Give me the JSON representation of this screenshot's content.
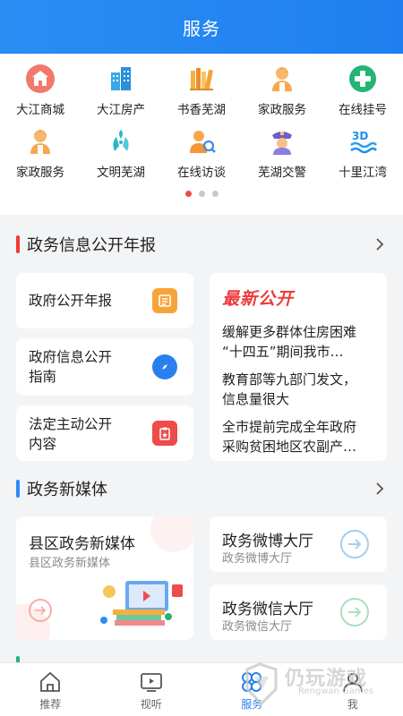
{
  "header": {
    "title": "服务"
  },
  "services": [
    {
      "label": "大江商城",
      "icon": "shopping-mall-icon",
      "color": "#ee6b5a"
    },
    {
      "label": "大江房产",
      "icon": "building-icon",
      "color": "#2aa0e6"
    },
    {
      "label": "书香芜湖",
      "icon": "books-icon",
      "color": "#f2a532"
    },
    {
      "label": "家政服务",
      "icon": "housekeeper-icon",
      "color": "#f5a84e"
    },
    {
      "label": "在线挂号",
      "icon": "medical-cross-icon",
      "color": "#22b573"
    },
    {
      "label": "家政服务",
      "icon": "housekeeper-icon",
      "color": "#f5a84e"
    },
    {
      "label": "文明芜湖",
      "icon": "hands-icon",
      "color": "#2fb4c8"
    },
    {
      "label": "在线访谈",
      "icon": "interview-icon",
      "color": "#f5963a"
    },
    {
      "label": "芜湖交警",
      "icon": "police-icon",
      "color": "#7b6fd6"
    },
    {
      "label": "十里江湾",
      "icon": "3d-river-icon",
      "color": "#1f8ff0"
    }
  ],
  "pager": {
    "count": 3,
    "active": 0
  },
  "section1": {
    "title": "政务信息公开年报",
    "bar_color": "#ee3b3b"
  },
  "cards": {
    "annual_report": {
      "label": "政府公开年报"
    },
    "guide": {
      "line1": "政府信息公开",
      "line2": "指南"
    },
    "statutory": {
      "line1": "法定主动公开",
      "line2": "内容"
    }
  },
  "latest": {
    "title": "最新公开",
    "items": [
      {
        "line1": "缓解更多群体住房困难",
        "line2": "“十四五”期间我市…"
      },
      {
        "line1": "教育部等九部门发文，",
        "line2": "信息量很大"
      },
      {
        "line1": "全市提前完成全年政府",
        "line2": "采购贫困地区农副产…"
      }
    ]
  },
  "section2": {
    "title": "政务新媒体",
    "bar_color": "#2a8df4"
  },
  "media": {
    "county": {
      "title": "县区政务新媒体",
      "sub": "县区政务新媒体"
    },
    "weibo": {
      "title": "政务微博大厅",
      "sub": "政务微博大厅"
    },
    "wechat": {
      "title": "政务微信大厅",
      "sub": "政务微信大厅"
    }
  },
  "tabs": [
    {
      "label": "推荐",
      "icon": "home-icon",
      "active": false
    },
    {
      "label": "视听",
      "icon": "tv-play-icon",
      "active": false
    },
    {
      "label": "服务",
      "icon": "service-icon",
      "active": true
    },
    {
      "label": "我",
      "icon": "user-icon",
      "active": false
    }
  ],
  "watermark": {
    "text": "仍玩游戏",
    "sub": "Rengwan Games"
  }
}
